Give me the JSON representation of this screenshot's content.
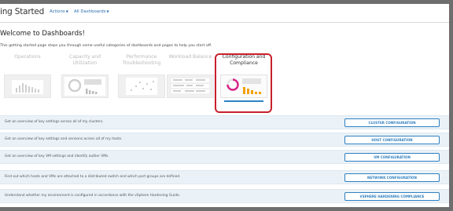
{
  "header": {
    "title": "ing Started",
    "actions_label": "Actions",
    "dashboards_label": "All Dashboards"
  },
  "intro": {
    "heading": "Welcome to Dashboards!",
    "subtitle": "This getting started page steps you through some useful categories of dashboards and pages to help you start off."
  },
  "categories": [
    {
      "label": "Operations",
      "active": false
    },
    {
      "label": "Capacity and Utilization",
      "active": false
    },
    {
      "label": "Performance Troubleshooting",
      "active": false
    },
    {
      "label": "Workload Balance",
      "active": false
    },
    {
      "label": "Configuration and Compliance",
      "active": true
    }
  ],
  "rows": [
    {
      "description": "Get an overview of key settings across all of my clusters.",
      "button": "CLUSTER CONFIGURATION"
    },
    {
      "description": "Get an overview of key settings and versions across all of my hosts.",
      "button": "HOST CONFIGURATION"
    },
    {
      "description": "Get an overview of key VM settings and identify outlier VMs.",
      "button": "VM CONFIGURATION"
    },
    {
      "description": "Find out which hosts and VMs are attached to a distributed switch and which port groups are defined.",
      "button": "NETWORK CONFIGURATION"
    },
    {
      "description": "Understand whether my environment is configured in accordance with the vSphere Hardening Guide.",
      "button": "VSPHERE HARDENING COMPLIANCE"
    }
  ],
  "colors": {
    "accent": "#2f7fbf",
    "highlight": "#c8202b",
    "row_background": "#eaf2f8"
  }
}
